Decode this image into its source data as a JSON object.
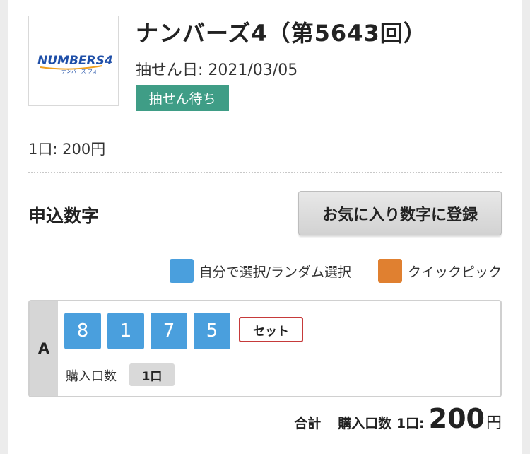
{
  "product": {
    "logo_text": "NUMBERS4",
    "logo_subtext": "ナンバーズ フォー",
    "title": "ナンバーズ4（第5643回）",
    "draw_date": "抽せん日: 2021/03/05",
    "status": "抽せん待ち",
    "unit_price": "1口: 200円"
  },
  "entry": {
    "section_title": "申込数字",
    "favorite_button": "お気に入り数字に登録"
  },
  "legend": [
    {
      "label": "自分で選択/ランダム選択",
      "color": "#4a9fdd"
    },
    {
      "label": "クイックピック",
      "color": "#e08030"
    }
  ],
  "row": {
    "letter": "A",
    "digits": [
      "8",
      "1",
      "7",
      "5"
    ],
    "bet_type": "セット",
    "qty_label": "購入口数",
    "qty_value": "1口"
  },
  "total": {
    "label": "合計",
    "qty_label": "購入口数 1口:",
    "amount": "200",
    "currency": "円"
  }
}
